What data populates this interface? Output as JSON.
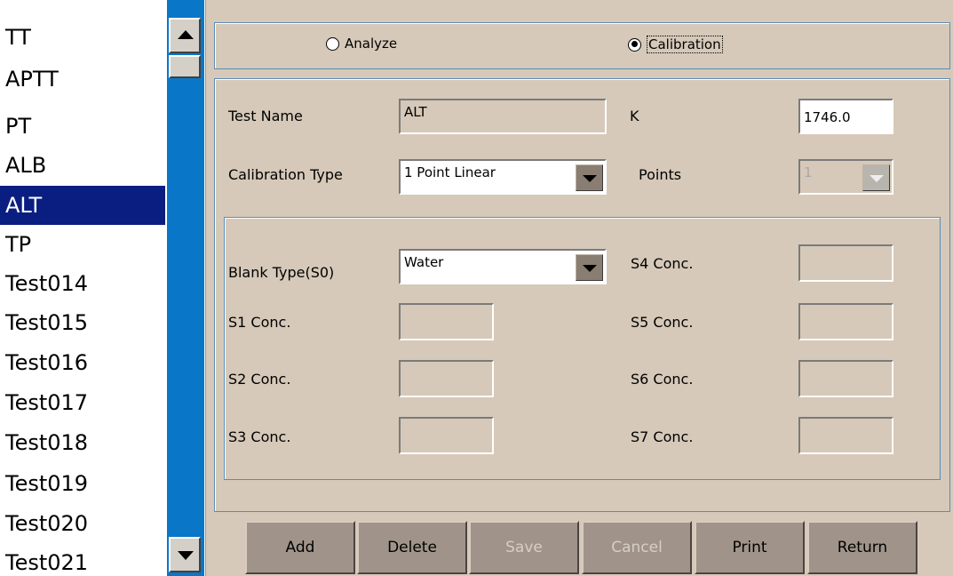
{
  "test_list": {
    "items": [
      "TT",
      "APTT",
      "PT",
      "ALB",
      "ALT",
      "TP",
      "Test014",
      "Test015",
      "Test016",
      "Test017",
      "Test018",
      "Test019",
      "Test020",
      "Test021"
    ],
    "selected": "ALT"
  },
  "mode": {
    "analyze_label": "Analyze",
    "calibration_label": "Calibration",
    "selected": "Calibration"
  },
  "form": {
    "test_name_label": "Test Name",
    "test_name_value": "ALT",
    "k_label": "K",
    "k_value": "1746.0",
    "calibration_type_label": "Calibration Type",
    "calibration_type_value": "1 Point Linear",
    "points_label": "Points",
    "points_value": "1",
    "blank_type_label": "Blank Type(S0)",
    "blank_type_value": "Water",
    "s1_label": "S1 Conc.",
    "s2_label": "S2 Conc.",
    "s3_label": "S3 Conc.",
    "s4_label": "S4 Conc.",
    "s5_label": "S5 Conc.",
    "s6_label": "S6 Conc.",
    "s7_label": "S7 Conc."
  },
  "buttons": {
    "add": "Add",
    "delete": "Delete",
    "save": "Save",
    "cancel": "Cancel",
    "print": "Print",
    "return": "Return"
  },
  "colors": {
    "background": "#d6c9b9",
    "selection": "#0a1e82",
    "scrollbar_track": "#0a76c8",
    "button_face": "#a0948a"
  }
}
